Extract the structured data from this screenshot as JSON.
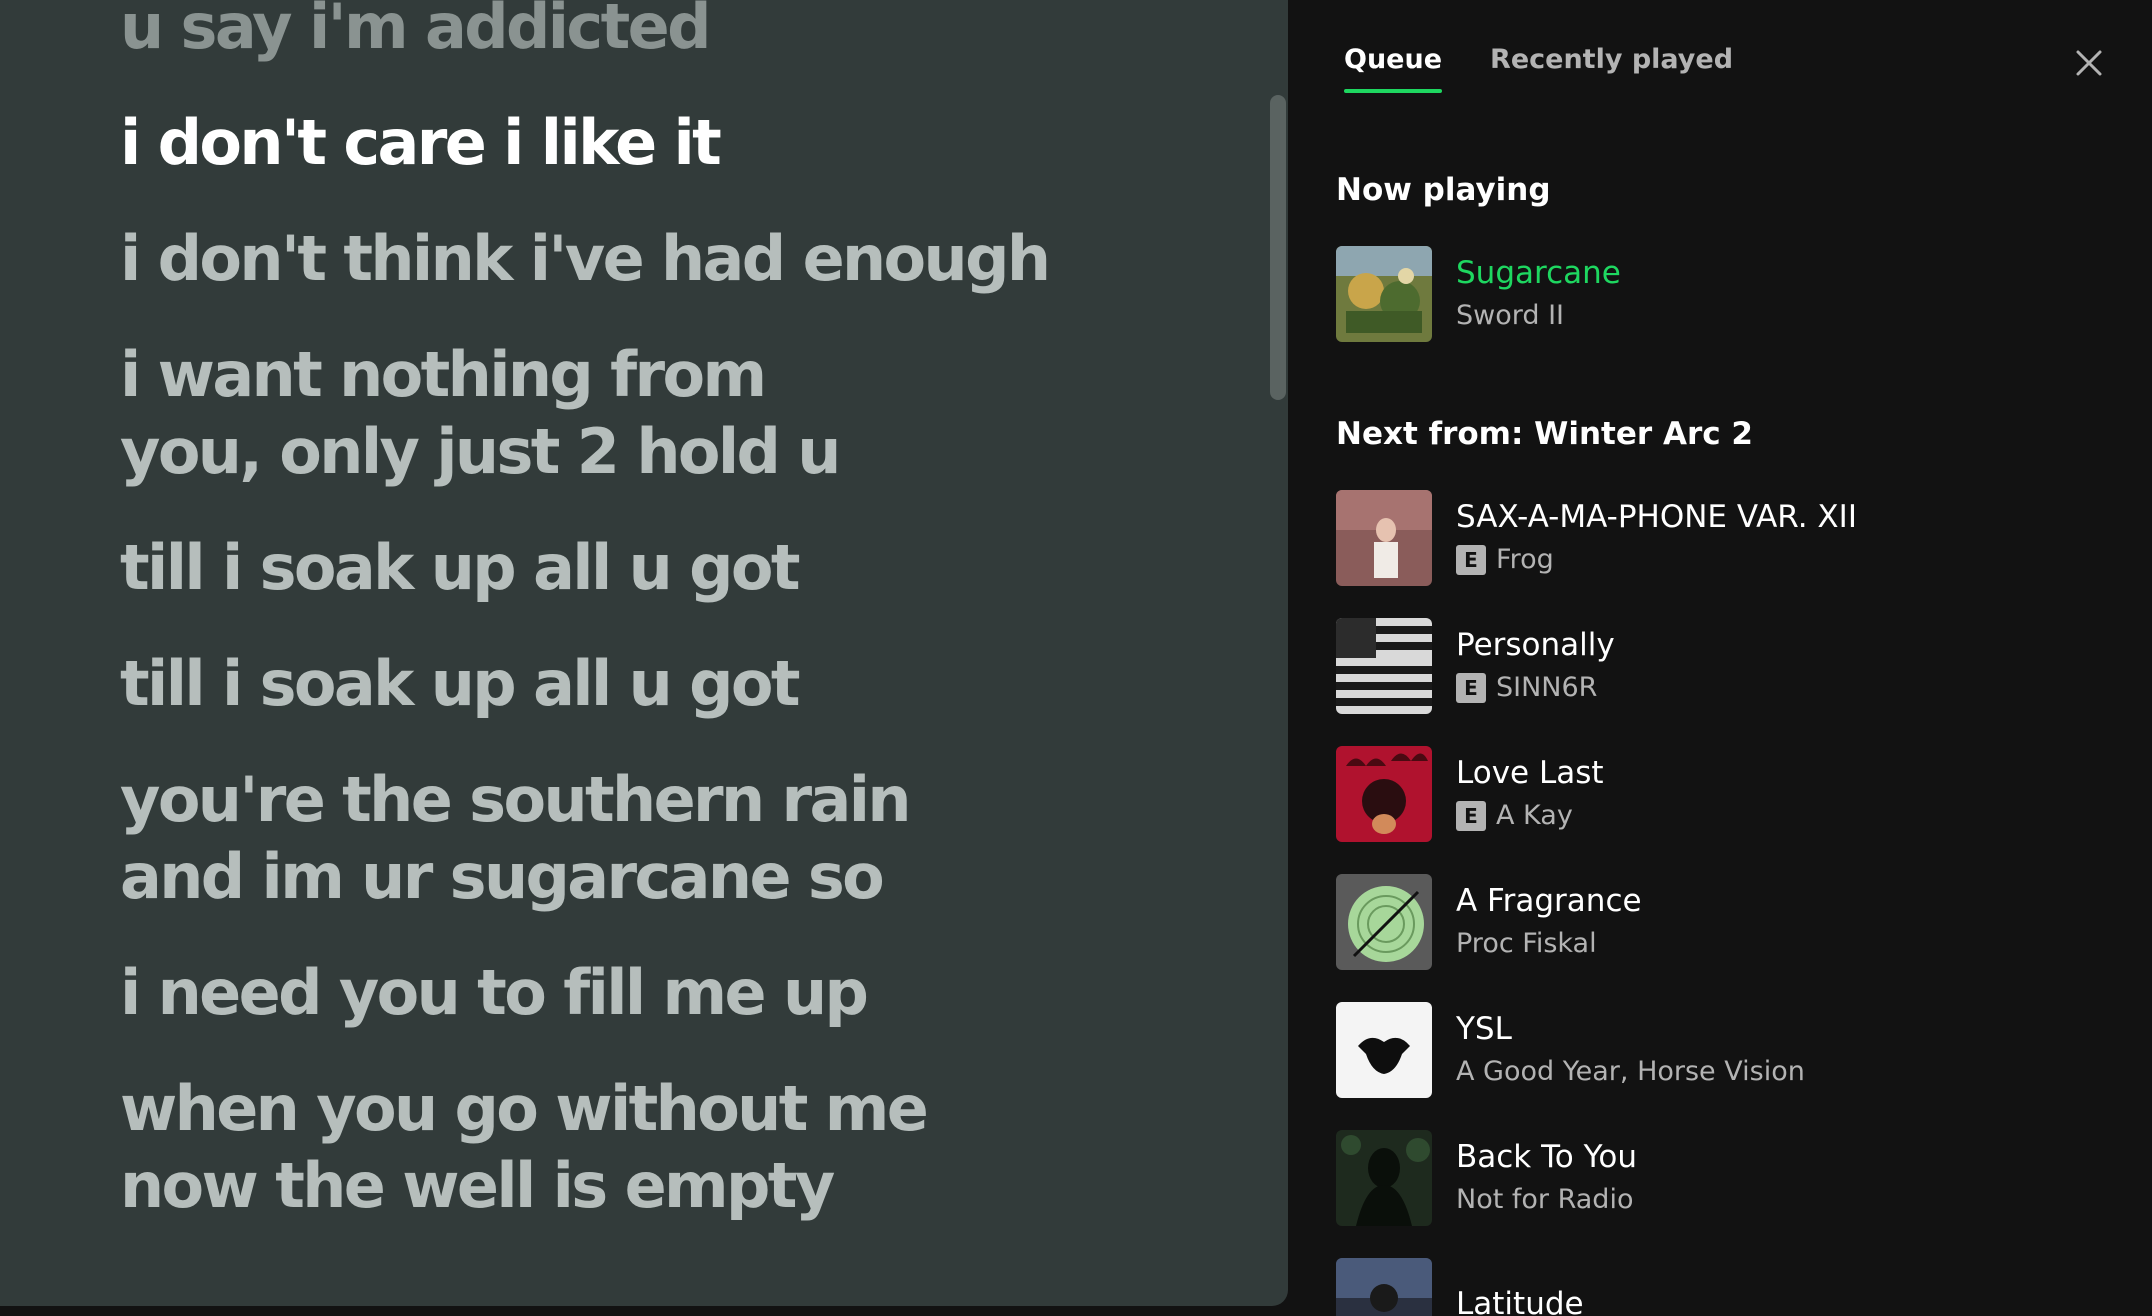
{
  "lyrics": [
    {
      "text": "u say i'm addicted",
      "state": "past"
    },
    {
      "text": "i don't care i like it",
      "state": "active"
    },
    {
      "text": "i don't think i've had enough",
      "state": "future"
    },
    {
      "text": "i want nothing from\nyou, only just 2 hold u",
      "state": "future"
    },
    {
      "text": "till i soak up all u got",
      "state": "future"
    },
    {
      "text": "till i soak up all u got",
      "state": "future"
    },
    {
      "text": "you're the southern rain\nand im ur sugarcane so",
      "state": "future"
    },
    {
      "text": "i need you to fill me up",
      "state": "future"
    },
    {
      "text": "when you go without me\nnow the well is empty",
      "state": "future"
    }
  ],
  "queue": {
    "tabs": [
      "Queue",
      "Recently played"
    ],
    "active_tab": "Queue",
    "now_playing_heading": "Now playing",
    "now_playing": {
      "title": "Sugarcane",
      "artist": "Sword II",
      "cover_icon": "album-art"
    },
    "next_heading": "Next from: Winter Arc 2",
    "next": [
      {
        "title": "SAX-A-MA-PHONE VAR. XII",
        "artist": "Frog",
        "explicit": true,
        "explicit_label": "E"
      },
      {
        "title": "Personally",
        "artist": "SINN6R",
        "explicit": true,
        "explicit_label": "E"
      },
      {
        "title": "Love Last",
        "artist": "A Kay",
        "explicit": true,
        "explicit_label": "E"
      },
      {
        "title": "A Fragrance",
        "artist": "Proc Fiskal",
        "explicit": false
      },
      {
        "title": "YSL",
        "artist": "A Good Year, Horse Vision",
        "explicit": false
      },
      {
        "title": "Back To You",
        "artist": "Not for Radio",
        "explicit": false
      },
      {
        "title": "Latitude",
        "artist": "",
        "explicit": false
      }
    ]
  },
  "colors": {
    "accent": "#1ed760",
    "lyrics_bg": "#323b3a",
    "panel_bg": "#121212"
  },
  "icons": {
    "close": "close-icon"
  }
}
